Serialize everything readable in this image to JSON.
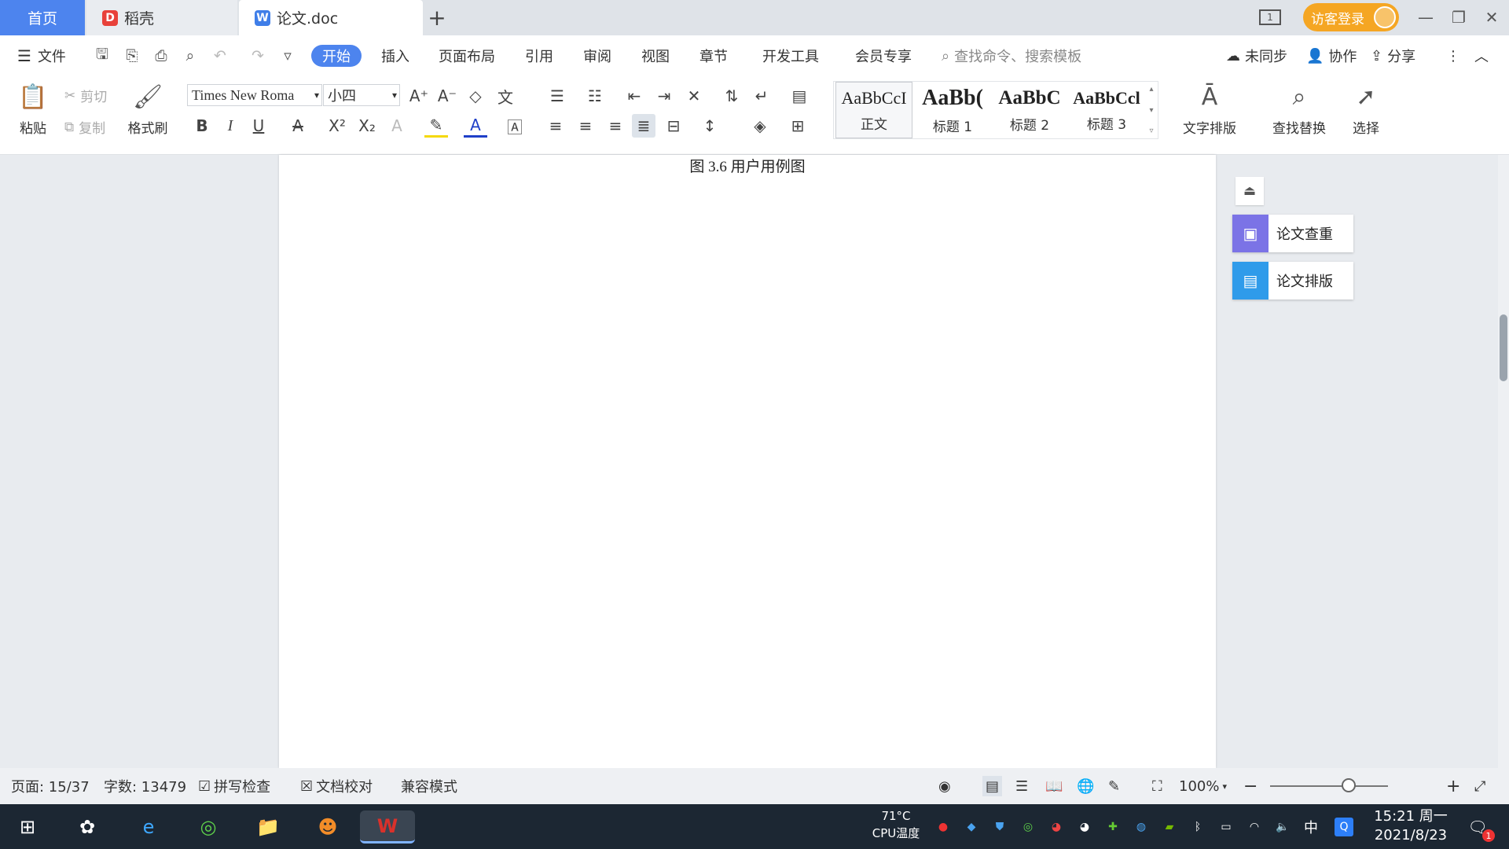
{
  "tabs": {
    "home": "首页",
    "docer": "稻壳",
    "doc": "论文.doc",
    "new_tab": "+"
  },
  "window": {
    "login": "访客登录",
    "layout_badge": "1"
  },
  "menu": {
    "file": "文件",
    "items": [
      "开始",
      "插入",
      "页面布局",
      "引用",
      "审阅",
      "视图",
      "章节",
      "开发工具",
      "会员专享"
    ],
    "search_placeholder": "查找命令、搜索模板",
    "sync": "未同步",
    "collab": "协作",
    "share": "分享"
  },
  "ribbon": {
    "paste": "粘贴",
    "cut": "剪切",
    "copy": "复制",
    "format_painter": "格式刷",
    "font_name": "Times New Roma",
    "font_size": "小四",
    "styles": [
      {
        "preview": "AaBbCcI",
        "name": "正文"
      },
      {
        "preview": "AaBb(",
        "name": "标题 1"
      },
      {
        "preview": "AaBbC",
        "name": "标题 2"
      },
      {
        "preview": "AaBbCcl",
        "name": "标题 3"
      }
    ],
    "text_layout": "文字排版",
    "find_replace": "查找替换",
    "select": "选择"
  },
  "document": {
    "caption": "图 3.6  用户用例图"
  },
  "side_panel": {
    "check": "论文查重",
    "format": "论文排版"
  },
  "status": {
    "page": "页面: 15/37",
    "words": "字数: 13479",
    "spell": "拼写检查",
    "proof": "文档校对",
    "compat": "兼容模式",
    "zoom": "100%"
  },
  "taskbar": {
    "cpu_temp": "71°C",
    "cpu_label": "CPU温度",
    "ime": "中",
    "time": "15:21 周一",
    "date": "2021/8/23",
    "notification_count": "1"
  },
  "colors": {
    "accent": "#4d84ee",
    "login": "#f5a623",
    "check_icon": "#7b73e6",
    "format_icon": "#2f9bea",
    "wps_red": "#d9312b"
  }
}
